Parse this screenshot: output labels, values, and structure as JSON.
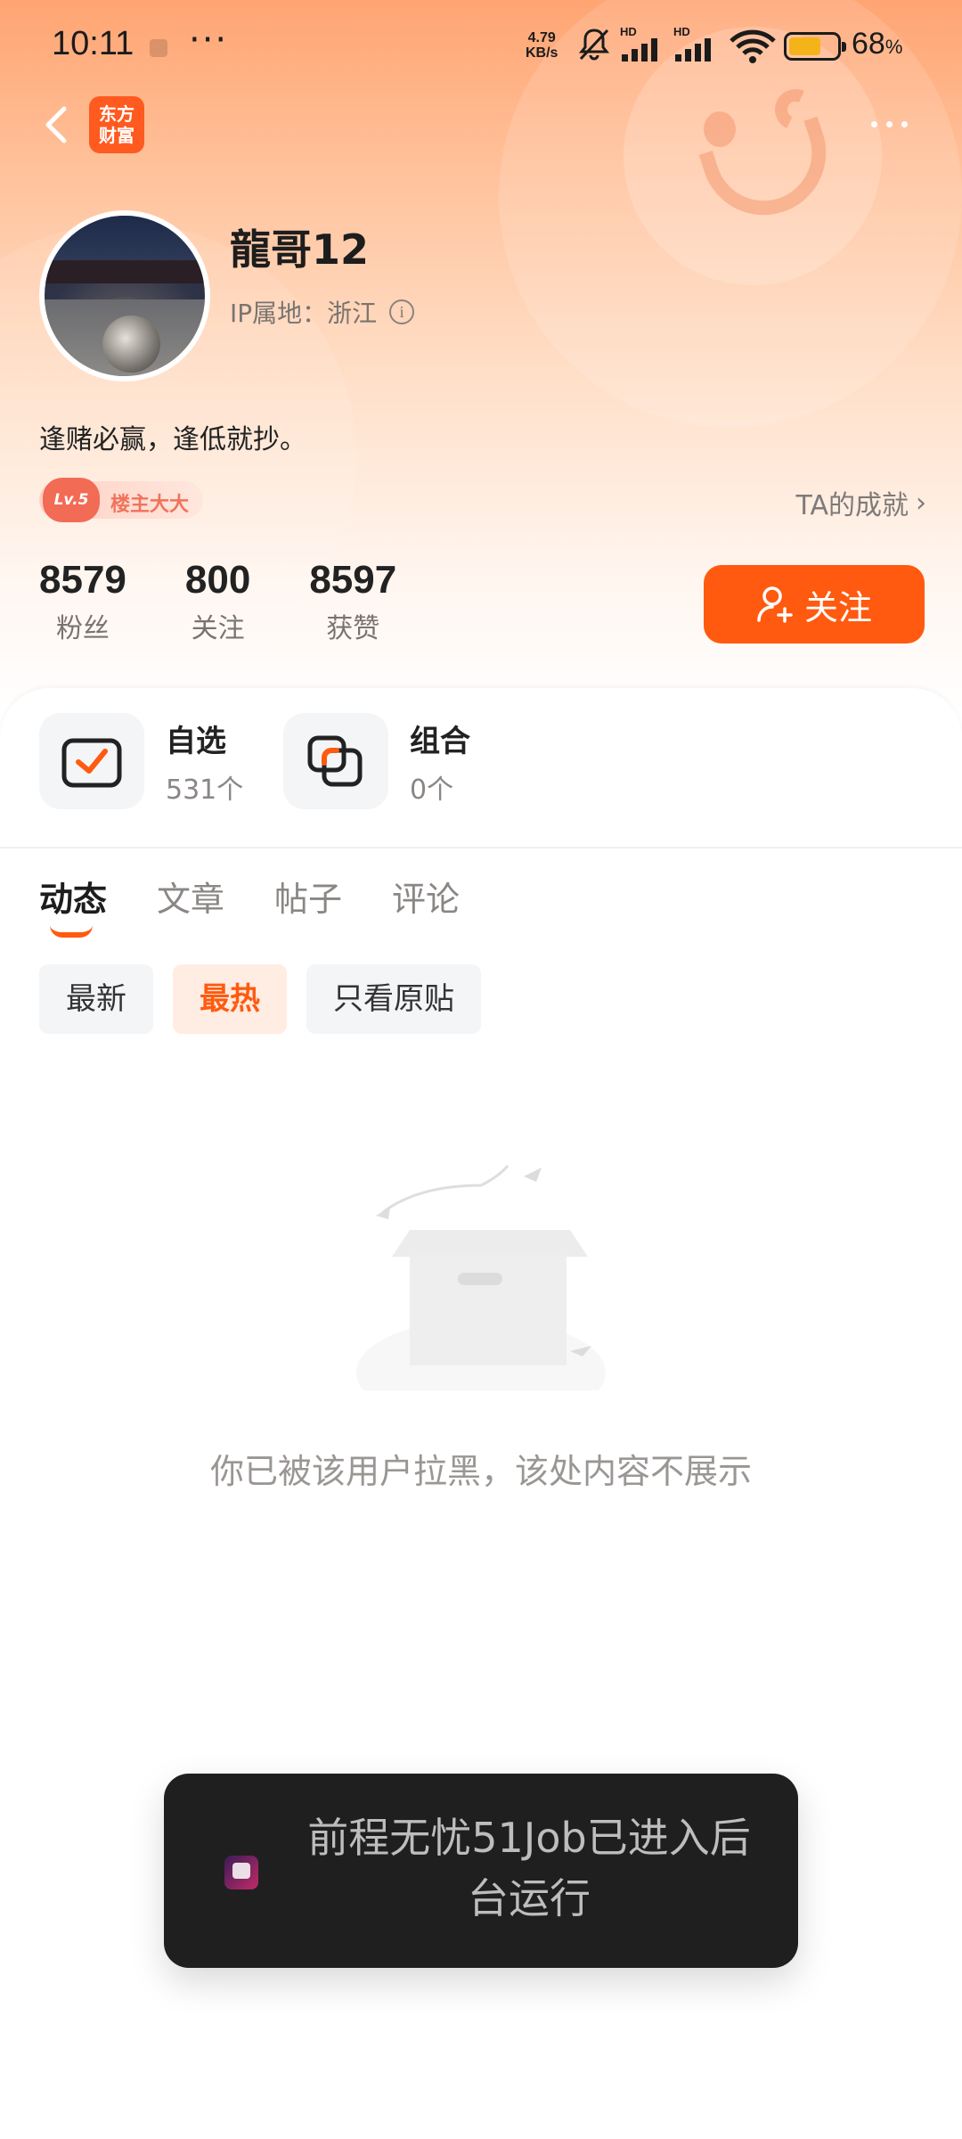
{
  "status_bar": {
    "time": "10:11",
    "more_dots": "···",
    "net_speed_value": "4.79",
    "net_speed_unit": "KB/s",
    "signal1_label": "HD",
    "signal2_label": "HD",
    "battery_percent": "68",
    "battery_unit": "%",
    "battery_level": 0.68,
    "battery_color": "#f5b31a"
  },
  "nav": {
    "logo_line1": "东方",
    "logo_line2": "财富",
    "brand_color": "#ff5a1f"
  },
  "profile": {
    "name": "龍哥12",
    "ip_location": "IP属地：浙江",
    "bio": "逢赌必赢，逢低就抄。",
    "badge_level": "Lv.5",
    "badge_title": "楼主大大",
    "achievements_link": "TA的成就"
  },
  "stats": [
    {
      "value": "8579",
      "label": "粉丝"
    },
    {
      "value": "800",
      "label": "关注"
    },
    {
      "value": "8597",
      "label": "获赞"
    }
  ],
  "follow_button": {
    "label": "关注",
    "color": "#ff5a0f"
  },
  "quick_links": [
    {
      "title": "自选",
      "sub": "531个",
      "icon": "checkbox-icon"
    },
    {
      "title": "组合",
      "sub": "0个",
      "icon": "overlap-squares-icon"
    }
  ],
  "tabs": [
    "动态",
    "文章",
    "帖子",
    "评论"
  ],
  "active_tab": "动态",
  "filter_chips": [
    "最新",
    "最热",
    "只看原贴"
  ],
  "active_chip": "最热",
  "empty_state": {
    "message": "你已被该用户拉黑，该处内容不展示",
    "icon": "empty-box-icon"
  },
  "toast": {
    "message": "前程无忧51Job已进入后台运行",
    "app_icon": "app-icon"
  }
}
